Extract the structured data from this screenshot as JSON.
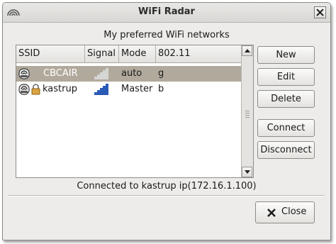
{
  "window": {
    "title": "WiFi Radar"
  },
  "main": {
    "subtitle": "My preferred WiFi networks",
    "columns": [
      "SSID",
      "Signal",
      "Mode",
      "802.11"
    ],
    "networks": [
      {
        "ssid": "CBCAIR",
        "signal": "weak",
        "mode": "auto",
        "protocol": "g",
        "selected": true,
        "locked": false
      },
      {
        "ssid": "kastrup",
        "signal": "strong",
        "mode": "Master",
        "protocol": "b",
        "selected": false,
        "locked": true
      }
    ]
  },
  "buttons": {
    "new": "New",
    "edit": "Edit",
    "delete": "Delete",
    "connect": "Connect",
    "disconnect": "Disconnect",
    "close": "Close"
  },
  "status": "Connected to kastrup ip(172.16.1.100)",
  "colors": {
    "selection": "#b1aa9c",
    "signal_strong": "#2a5ab8",
    "signal_weak": "#cfcfcf"
  }
}
